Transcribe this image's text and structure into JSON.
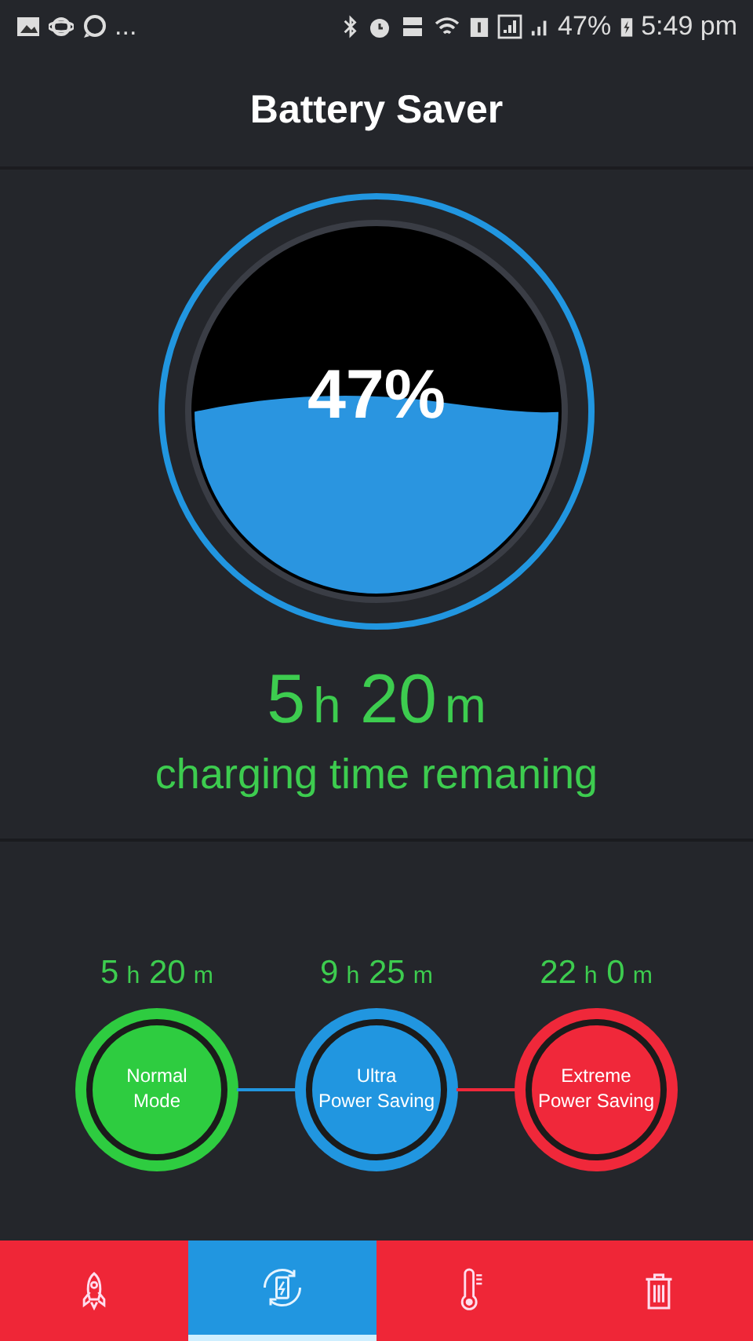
{
  "status_bar": {
    "overflow": "...",
    "battery": "47%",
    "time": "5:49 pm"
  },
  "app_bar": {
    "title": "Battery Saver"
  },
  "gauge": {
    "percent": "47%"
  },
  "remaining": {
    "hours": "5",
    "hours_unit": "h",
    "minutes": "20",
    "minutes_unit": "m",
    "label": "charging time remaning"
  },
  "modes": [
    {
      "hours": "5",
      "hours_unit": "h",
      "minutes": "20",
      "minutes_unit": "m",
      "line1": "Normal",
      "line2": "Mode",
      "color": "#2ecc40"
    },
    {
      "hours": "9",
      "hours_unit": "h",
      "minutes": "25",
      "minutes_unit": "m",
      "line1": "Ultra",
      "line2": "Power Saving",
      "color": "#2196e0"
    },
    {
      "hours": "22",
      "hours_unit": "h",
      "minutes": "0",
      "minutes_unit": "m",
      "line1": "Extreme",
      "line2": "Power Saving",
      "color": "#f0283a"
    }
  ],
  "tabs": [
    {
      "kind": "rocket",
      "selected": false
    },
    {
      "kind": "recycle",
      "selected": true
    },
    {
      "kind": "thermometer",
      "selected": false
    },
    {
      "kind": "trash",
      "selected": false
    }
  ]
}
